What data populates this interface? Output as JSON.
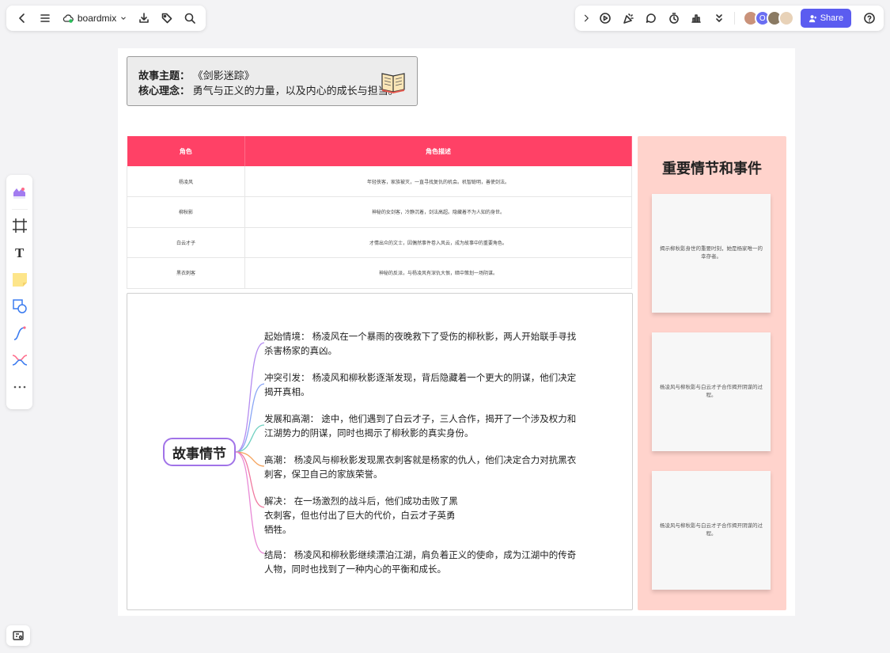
{
  "app": {
    "brand": "boardmix",
    "share_label": "Share"
  },
  "colors": {
    "accent": "#5b5cf0",
    "table_header": "#ff4166",
    "events_bg": "#ffd3cc",
    "mind_center_border": "#a173e8"
  },
  "theme": {
    "story_label": "故事主题",
    "story_value": "《剑影迷踪》",
    "core_label": "核心理念",
    "core_value": "勇气与正义的力量，以及内心的成长与担当。"
  },
  "characters": {
    "headers": [
      "角色",
      "角色描述"
    ],
    "rows": [
      {
        "name": "杨凌风",
        "desc": "年轻侠客，家族被灭，一直寻找复仇的机会。机智聪明，善使剑法。"
      },
      {
        "name": "柳秋影",
        "desc": "神秘的女剑客，冷静沉着，剑法高超。隐藏着不为人知的身世。"
      },
      {
        "name": "白云才子",
        "desc": "才情出众的文士，因偶然事件卷入风云，成为故事中的重要角色。"
      },
      {
        "name": "黑衣刺客",
        "desc": "神秘的反派，与杨凌风有深仇大恨，暗中策划一场阴谋。"
      }
    ]
  },
  "plot": {
    "center": "故事情节",
    "items": [
      {
        "text": "起始情境： 杨凌风在一个暴雨的夜晚救下了受伤的柳秋影，两人开始联手寻找杀害杨家的真凶。"
      },
      {
        "text": "冲突引发： 杨凌风和柳秋影逐渐发现，背后隐藏着一个更大的阴谋，他们决定揭开真相。"
      },
      {
        "text": "发展和高潮： 途中，他们遇到了白云才子，三人合作，揭开了一个涉及权力和江湖势力的阴谋，同时也揭示了柳秋影的真实身份。"
      },
      {
        "text": "高潮： 杨凌风与柳秋影发现黑衣刺客就是杨家的仇人，他们决定合力对抗黑衣刺客，保卫自己的家族荣誉。"
      },
      {
        "text": "解决： 在一场激烈的战斗后，他们成功击败了黑衣刺客，但也付出了巨大的代价，白云才子英勇牺牲。"
      },
      {
        "text": "结局： 杨凌风和柳秋影继续漂泊江湖，肩负着正义的使命，成为江湖中的传奇人物，同时也找到了一种内心的平衡和成长。"
      }
    ]
  },
  "events": {
    "title": "重要情节和事件",
    "cards": [
      {
        "text": "揭示柳秋影身世的重要时刻，她是杨家唯一的幸存者。"
      },
      {
        "text": "杨凌风与柳秋影与白云才子合作揭开阴谋的过程。"
      },
      {
        "text": "杨凌风与柳秋影与白云才子合作揭开阴谋的过程。"
      }
    ]
  }
}
